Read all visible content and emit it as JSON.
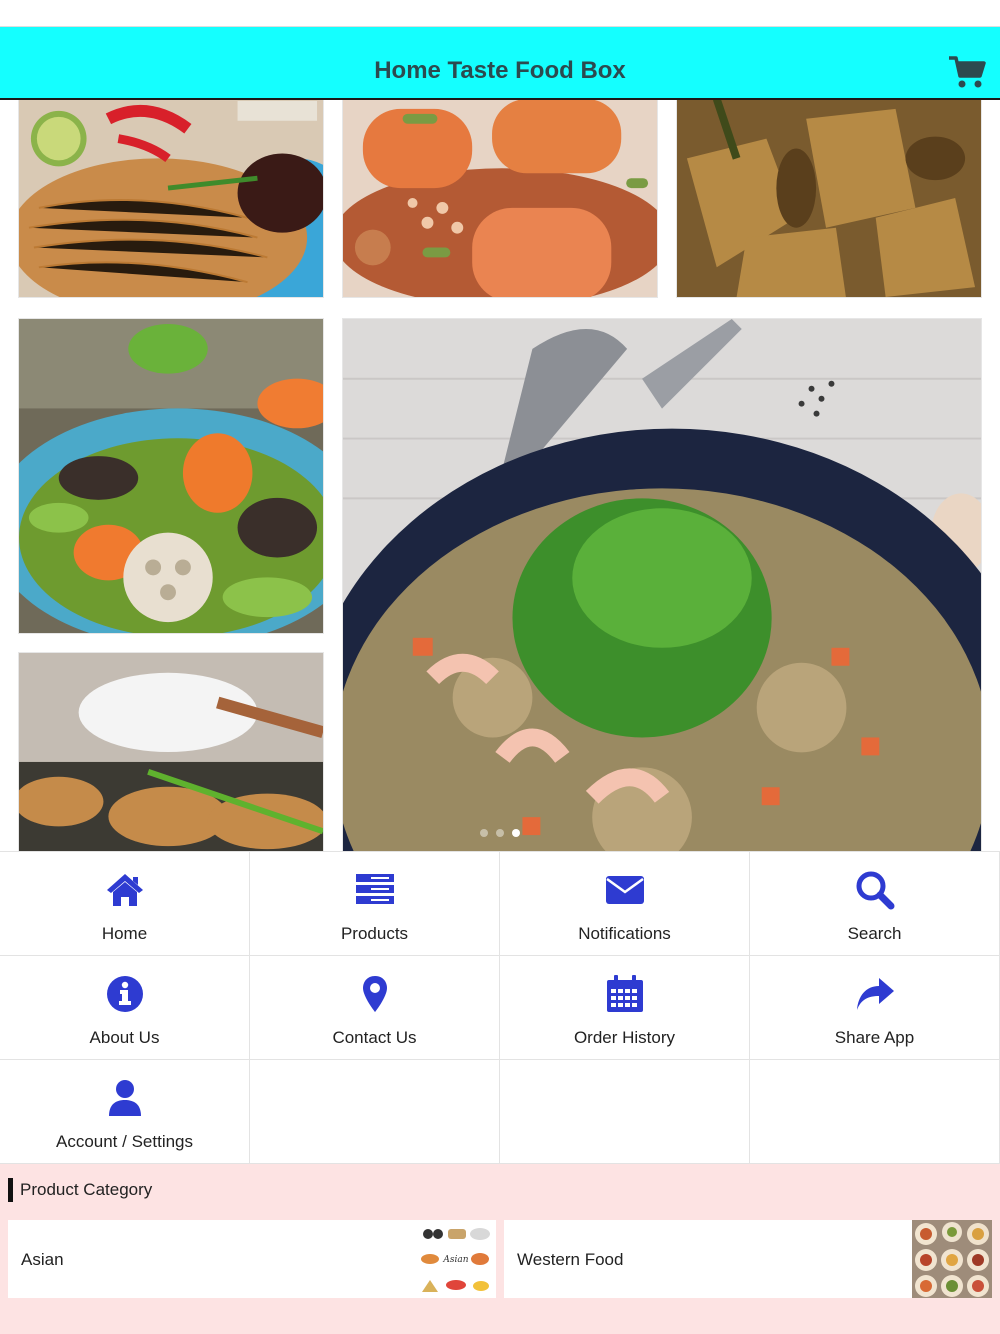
{
  "app": {
    "title": "Home Taste Food Box",
    "accent_color": "#14ffff",
    "icon_color": "#2e3bd1",
    "cart_icon": "shopping-cart-icon"
  },
  "slider": {
    "images": [
      "rice-vermicelli-dish",
      "tofu-minced-pork-dish",
      "curry-chicken-dish",
      "stir-fried-vegetables-lotus-root",
      "fried-tofu-soup-dish",
      "shrimp-fried-rice-dish"
    ],
    "page_count": 3,
    "active_page": 3
  },
  "menu": {
    "items": [
      {
        "label": "Home",
        "icon": "home-icon"
      },
      {
        "label": "Products",
        "icon": "list-icon"
      },
      {
        "label": "Notifications",
        "icon": "envelope-icon"
      },
      {
        "label": "Search",
        "icon": "search-icon"
      },
      {
        "label": "About Us",
        "icon": "info-icon"
      },
      {
        "label": "Contact Us",
        "icon": "map-pin-icon"
      },
      {
        "label": "Order History",
        "icon": "calendar-icon"
      },
      {
        "label": "Share App",
        "icon": "share-icon"
      },
      {
        "label": "Account / Settings",
        "icon": "user-icon"
      }
    ]
  },
  "category": {
    "title": "Product Category",
    "items": [
      {
        "name": "Asian",
        "thumb": "asian-food-thumbnail"
      },
      {
        "name": "Western Food",
        "thumb": "western-food-thumbnail"
      }
    ]
  }
}
